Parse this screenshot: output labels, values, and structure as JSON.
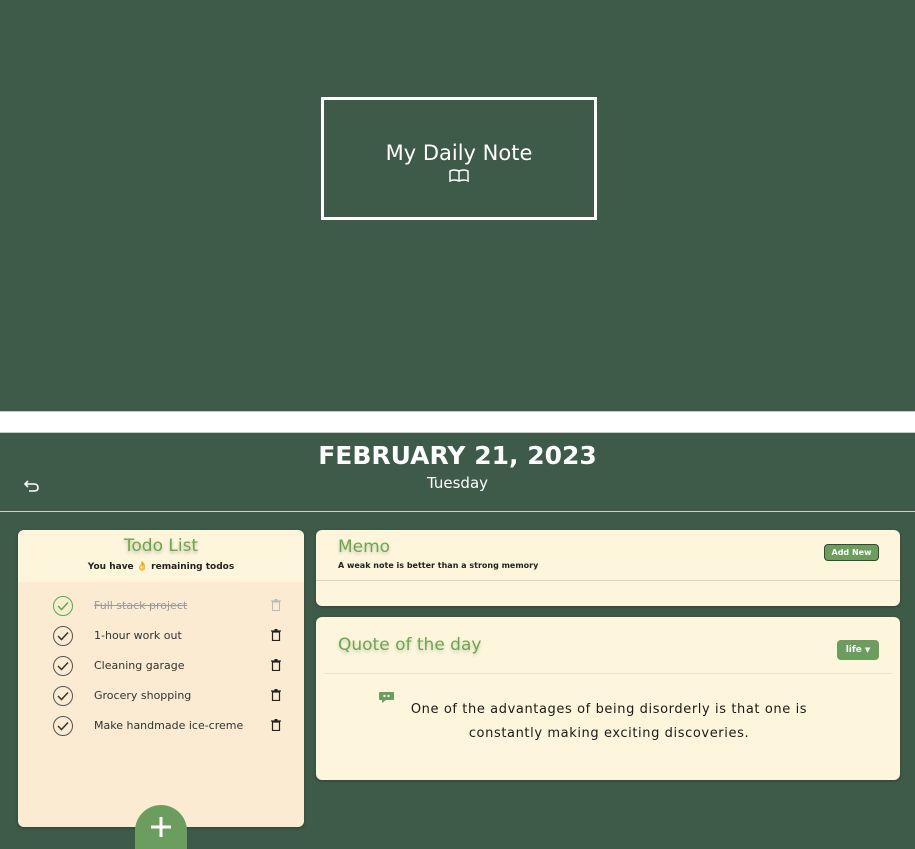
{
  "hero": {
    "title": "My Daily Note",
    "icon": "open-book-icon"
  },
  "header": {
    "date": "FEBRUARY 21, 2023",
    "weekday": "Tuesday",
    "back_icon": "undo-arrow-icon"
  },
  "todo": {
    "title": "Todo List",
    "subtitle_prefix": "You have",
    "subtitle_emoji": "👌",
    "subtitle_suffix": "remaining todos",
    "items": [
      {
        "label": "Full stack project",
        "done": true
      },
      {
        "label": "1-hour work out",
        "done": false
      },
      {
        "label": "Cleaning garage",
        "done": false
      },
      {
        "label": "Grocery shopping",
        "done": false
      },
      {
        "label": "Make handmade ice-creme",
        "done": false
      }
    ],
    "add_icon": "plus-icon"
  },
  "memo": {
    "title": "Memo",
    "subtitle": "A weak note is better than a strong memory",
    "add_label": "Add New"
  },
  "quote": {
    "title": "Quote of the day",
    "category": "life",
    "text": "One of the advantages of being disorderly is that one is constantly making exciting discoveries."
  },
  "colors": {
    "background": "#3e5a48",
    "accent": "#6b9e5e",
    "card": "#fdf6dc",
    "todo_card": "#faebd2"
  }
}
